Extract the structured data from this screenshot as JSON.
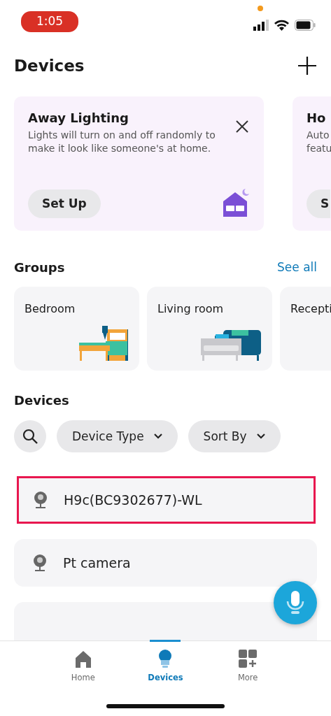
{
  "status_bar": {
    "time": "1:05"
  },
  "header": {
    "title": "Devices"
  },
  "promo_cards": [
    {
      "title": "Away Lighting",
      "text": "Lights will turn on and off randomly to make it look like someone's at home.",
      "button": "Set Up",
      "dismissible": true
    },
    {
      "title": "Ho",
      "text_lines": [
        "Auto",
        "featu"
      ],
      "button": "S",
      "dismissible": false
    }
  ],
  "groups": {
    "title": "Groups",
    "link": "See all",
    "items": [
      {
        "name": "Bedroom",
        "kind": "bed"
      },
      {
        "name": "Living room",
        "kind": "sofa"
      },
      {
        "name": "Recepti",
        "kind": "none"
      }
    ]
  },
  "devices": {
    "title": "Devices",
    "filters": [
      "Device Type",
      "Sort By"
    ],
    "items": [
      {
        "name": "H9c(BC9302677)-WL",
        "highlighted": true
      },
      {
        "name": "Pt camera",
        "highlighted": false
      }
    ]
  },
  "tabs": [
    {
      "label": "Home",
      "kind": "home",
      "selected": false
    },
    {
      "label": "Devices",
      "kind": "bulb",
      "selected": true
    },
    {
      "label": "More",
      "kind": "more",
      "selected": false
    }
  ]
}
